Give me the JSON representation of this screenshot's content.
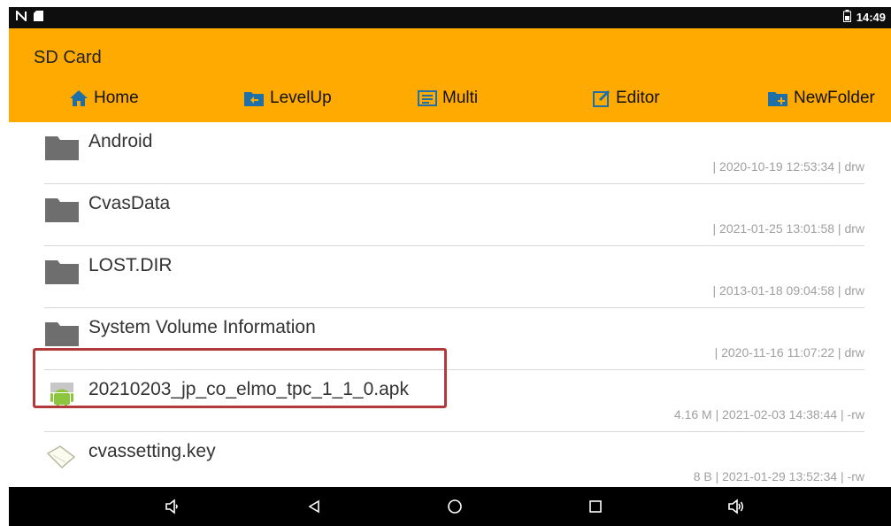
{
  "status_bar": {
    "left_icons": [
      "nfc-icon",
      "sd-card-icon"
    ],
    "right_icons": [
      "battery-icon"
    ],
    "time": "14:49"
  },
  "app": {
    "title": "SD Card",
    "accent_color": "#ffaa00"
  },
  "toolbar": {
    "home_label": "Home",
    "levelup_label": "LevelUp",
    "multi_label": "Multi",
    "editor_label": "Editor",
    "newfolder_label": "NewFolder"
  },
  "files": [
    {
      "name": "Android",
      "meta": "| 2020-10-19 12:53:34 | drw",
      "type": "folder"
    },
    {
      "name": "CvasData",
      "meta": "| 2021-01-25 13:01:58 | drw",
      "type": "folder"
    },
    {
      "name": "LOST.DIR",
      "meta": "| 2013-01-18 09:04:58 | drw",
      "type": "folder"
    },
    {
      "name": "System Volume Information",
      "meta": "| 2020-11-16 11:07:22 | drw",
      "type": "folder"
    },
    {
      "name": "20210203_jp_co_elmo_tpc_1_1_0.apk",
      "meta": "4.16 M | 2021-02-03 14:38:44 | -rw",
      "type": "apk"
    },
    {
      "name": "cvassetting.key",
      "meta": "8 B | 2021-01-29 13:52:34 | -rw",
      "type": "file"
    }
  ],
  "nav_bar": {
    "buttons": [
      "volume-down-icon",
      "back-icon",
      "home-circle-icon",
      "recents-icon",
      "volume-up-icon"
    ]
  }
}
